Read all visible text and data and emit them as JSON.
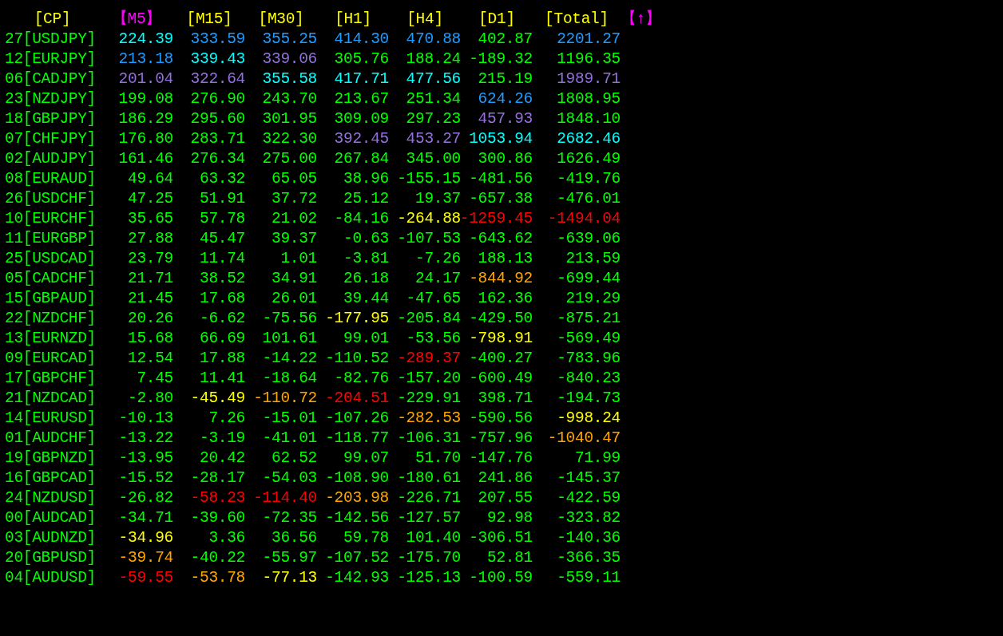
{
  "header": [
    {
      "text": "[CP]",
      "selected": false
    },
    {
      "text": "【M5】",
      "selected": true
    },
    {
      "text": "[M15]",
      "selected": false
    },
    {
      "text": "[M30]",
      "selected": false
    },
    {
      "text": "[H1]",
      "selected": false
    },
    {
      "text": "[H4]",
      "selected": false
    },
    {
      "text": "[D1]",
      "selected": false
    },
    {
      "text": "[Total]",
      "selected": false
    }
  ],
  "sort_indicator": "【↑】",
  "rows": [
    {
      "pair": "27[USDJPY]",
      "values": [
        {
          "text": "224.39",
          "color": "#00ffff"
        },
        {
          "text": "333.59",
          "color": "#1e9bff"
        },
        {
          "text": "355.25",
          "color": "#1e9bff"
        },
        {
          "text": "414.30",
          "color": "#1e9bff"
        },
        {
          "text": "470.88",
          "color": "#1e9bff"
        },
        {
          "text": "402.87",
          "color": "#00ff00"
        },
        {
          "text": "2201.27",
          "color": "#1e9bff"
        }
      ]
    },
    {
      "pair": "12[EURJPY]",
      "values": [
        {
          "text": "213.18",
          "color": "#1e9bff"
        },
        {
          "text": "339.43",
          "color": "#00ffff"
        },
        {
          "text": "339.06",
          "color": "#9370db"
        },
        {
          "text": "305.76",
          "color": "#00ff00"
        },
        {
          "text": "188.24",
          "color": "#00ff00"
        },
        {
          "text": "-189.32",
          "color": "#00ff00"
        },
        {
          "text": "1196.35",
          "color": "#00ff00"
        }
      ]
    },
    {
      "pair": "06[CADJPY]",
      "values": [
        {
          "text": "201.04",
          "color": "#9370db"
        },
        {
          "text": "322.64",
          "color": "#9370db"
        },
        {
          "text": "355.58",
          "color": "#00ffff"
        },
        {
          "text": "417.71",
          "color": "#00ffff"
        },
        {
          "text": "477.56",
          "color": "#00ffff"
        },
        {
          "text": "215.19",
          "color": "#00ff00"
        },
        {
          "text": "1989.71",
          "color": "#9370db"
        }
      ]
    },
    {
      "pair": "23[NZDJPY]",
      "values": [
        {
          "text": "199.08",
          "color": "#00ff00"
        },
        {
          "text": "276.90",
          "color": "#00ff00"
        },
        {
          "text": "243.70",
          "color": "#00ff00"
        },
        {
          "text": "213.67",
          "color": "#00ff00"
        },
        {
          "text": "251.34",
          "color": "#00ff00"
        },
        {
          "text": "624.26",
          "color": "#1e9bff"
        },
        {
          "text": "1808.95",
          "color": "#00ff00"
        }
      ]
    },
    {
      "pair": "18[GBPJPY]",
      "values": [
        {
          "text": "186.29",
          "color": "#00ff00"
        },
        {
          "text": "295.60",
          "color": "#00ff00"
        },
        {
          "text": "301.95",
          "color": "#00ff00"
        },
        {
          "text": "309.09",
          "color": "#00ff00"
        },
        {
          "text": "297.23",
          "color": "#00ff00"
        },
        {
          "text": "457.93",
          "color": "#9370db"
        },
        {
          "text": "1848.10",
          "color": "#00ff00"
        }
      ]
    },
    {
      "pair": "07[CHFJPY]",
      "values": [
        {
          "text": "176.80",
          "color": "#00ff00"
        },
        {
          "text": "283.71",
          "color": "#00ff00"
        },
        {
          "text": "322.30",
          "color": "#00ff00"
        },
        {
          "text": "392.45",
          "color": "#9370db"
        },
        {
          "text": "453.27",
          "color": "#9370db"
        },
        {
          "text": "1053.94",
          "color": "#00ffff"
        },
        {
          "text": "2682.46",
          "color": "#00ffff"
        }
      ]
    },
    {
      "pair": "02[AUDJPY]",
      "values": [
        {
          "text": "161.46",
          "color": "#00ff00"
        },
        {
          "text": "276.34",
          "color": "#00ff00"
        },
        {
          "text": "275.00",
          "color": "#00ff00"
        },
        {
          "text": "267.84",
          "color": "#00ff00"
        },
        {
          "text": "345.00",
          "color": "#00ff00"
        },
        {
          "text": "300.86",
          "color": "#00ff00"
        },
        {
          "text": "1626.49",
          "color": "#00ff00"
        }
      ]
    },
    {
      "pair": "08[EURAUD]",
      "values": [
        {
          "text": "49.64",
          "color": "#00ff00"
        },
        {
          "text": "63.32",
          "color": "#00ff00"
        },
        {
          "text": "65.05",
          "color": "#00ff00"
        },
        {
          "text": "38.96",
          "color": "#00ff00"
        },
        {
          "text": "-155.15",
          "color": "#00ff00"
        },
        {
          "text": "-481.56",
          "color": "#00ff00"
        },
        {
          "text": "-419.76",
          "color": "#00ff00"
        }
      ]
    },
    {
      "pair": "26[USDCHF]",
      "values": [
        {
          "text": "47.25",
          "color": "#00ff00"
        },
        {
          "text": "51.91",
          "color": "#00ff00"
        },
        {
          "text": "37.72",
          "color": "#00ff00"
        },
        {
          "text": "25.12",
          "color": "#00ff00"
        },
        {
          "text": "19.37",
          "color": "#00ff00"
        },
        {
          "text": "-657.38",
          "color": "#00ff00"
        },
        {
          "text": "-476.01",
          "color": "#00ff00"
        }
      ]
    },
    {
      "pair": "10[EURCHF]",
      "values": [
        {
          "text": "35.65",
          "color": "#00ff00"
        },
        {
          "text": "57.78",
          "color": "#00ff00"
        },
        {
          "text": "21.02",
          "color": "#00ff00"
        },
        {
          "text": "-84.16",
          "color": "#00ff00"
        },
        {
          "text": "-264.88",
          "color": "#ffff00"
        },
        {
          "text": "-1259.45",
          "color": "#ff0000"
        },
        {
          "text": "-1494.04",
          "color": "#ff0000"
        }
      ]
    },
    {
      "pair": "11[EURGBP]",
      "values": [
        {
          "text": "27.88",
          "color": "#00ff00"
        },
        {
          "text": "45.47",
          "color": "#00ff00"
        },
        {
          "text": "39.37",
          "color": "#00ff00"
        },
        {
          "text": "-0.63",
          "color": "#00ff00"
        },
        {
          "text": "-107.53",
          "color": "#00ff00"
        },
        {
          "text": "-643.62",
          "color": "#00ff00"
        },
        {
          "text": "-639.06",
          "color": "#00ff00"
        }
      ]
    },
    {
      "pair": "25[USDCAD]",
      "values": [
        {
          "text": "23.79",
          "color": "#00ff00"
        },
        {
          "text": "11.74",
          "color": "#00ff00"
        },
        {
          "text": "1.01",
          "color": "#00ff00"
        },
        {
          "text": "-3.81",
          "color": "#00ff00"
        },
        {
          "text": "-7.26",
          "color": "#00ff00"
        },
        {
          "text": "188.13",
          "color": "#00ff00"
        },
        {
          "text": "213.59",
          "color": "#00ff00"
        }
      ]
    },
    {
      "pair": "05[CADCHF]",
      "values": [
        {
          "text": "21.71",
          "color": "#00ff00"
        },
        {
          "text": "38.52",
          "color": "#00ff00"
        },
        {
          "text": "34.91",
          "color": "#00ff00"
        },
        {
          "text": "26.18",
          "color": "#00ff00"
        },
        {
          "text": "24.17",
          "color": "#00ff00"
        },
        {
          "text": "-844.92",
          "color": "#ffa500"
        },
        {
          "text": "-699.44",
          "color": "#00ff00"
        }
      ]
    },
    {
      "pair": "15[GBPAUD]",
      "values": [
        {
          "text": "21.45",
          "color": "#00ff00"
        },
        {
          "text": "17.68",
          "color": "#00ff00"
        },
        {
          "text": "26.01",
          "color": "#00ff00"
        },
        {
          "text": "39.44",
          "color": "#00ff00"
        },
        {
          "text": "-47.65",
          "color": "#00ff00"
        },
        {
          "text": "162.36",
          "color": "#00ff00"
        },
        {
          "text": "219.29",
          "color": "#00ff00"
        }
      ]
    },
    {
      "pair": "22[NZDCHF]",
      "values": [
        {
          "text": "20.26",
          "color": "#00ff00"
        },
        {
          "text": "-6.62",
          "color": "#00ff00"
        },
        {
          "text": "-75.56",
          "color": "#00ff00"
        },
        {
          "text": "-177.95",
          "color": "#ffff00"
        },
        {
          "text": "-205.84",
          "color": "#00ff00"
        },
        {
          "text": "-429.50",
          "color": "#00ff00"
        },
        {
          "text": "-875.21",
          "color": "#00ff00"
        }
      ]
    },
    {
      "pair": "13[EURNZD]",
      "values": [
        {
          "text": "15.68",
          "color": "#00ff00"
        },
        {
          "text": "66.69",
          "color": "#00ff00"
        },
        {
          "text": "101.61",
          "color": "#00ff00"
        },
        {
          "text": "99.01",
          "color": "#00ff00"
        },
        {
          "text": "-53.56",
          "color": "#00ff00"
        },
        {
          "text": "-798.91",
          "color": "#ffff00"
        },
        {
          "text": "-569.49",
          "color": "#00ff00"
        }
      ]
    },
    {
      "pair": "09[EURCAD]",
      "values": [
        {
          "text": "12.54",
          "color": "#00ff00"
        },
        {
          "text": "17.88",
          "color": "#00ff00"
        },
        {
          "text": "-14.22",
          "color": "#00ff00"
        },
        {
          "text": "-110.52",
          "color": "#00ff00"
        },
        {
          "text": "-289.37",
          "color": "#ff0000"
        },
        {
          "text": "-400.27",
          "color": "#00ff00"
        },
        {
          "text": "-783.96",
          "color": "#00ff00"
        }
      ]
    },
    {
      "pair": "17[GBPCHF]",
      "values": [
        {
          "text": "7.45",
          "color": "#00ff00"
        },
        {
          "text": "11.41",
          "color": "#00ff00"
        },
        {
          "text": "-18.64",
          "color": "#00ff00"
        },
        {
          "text": "-82.76",
          "color": "#00ff00"
        },
        {
          "text": "-157.20",
          "color": "#00ff00"
        },
        {
          "text": "-600.49",
          "color": "#00ff00"
        },
        {
          "text": "-840.23",
          "color": "#00ff00"
        }
      ]
    },
    {
      "pair": "21[NZDCAD]",
      "values": [
        {
          "text": "-2.80",
          "color": "#00ff00"
        },
        {
          "text": "-45.49",
          "color": "#ffff00"
        },
        {
          "text": "-110.72",
          "color": "#ffa500"
        },
        {
          "text": "-204.51",
          "color": "#ff0000"
        },
        {
          "text": "-229.91",
          "color": "#00ff00"
        },
        {
          "text": "398.71",
          "color": "#00ff00"
        },
        {
          "text": "-194.73",
          "color": "#00ff00"
        }
      ]
    },
    {
      "pair": "14[EURUSD]",
      "values": [
        {
          "text": "-10.13",
          "color": "#00ff00"
        },
        {
          "text": "7.26",
          "color": "#00ff00"
        },
        {
          "text": "-15.01",
          "color": "#00ff00"
        },
        {
          "text": "-107.26",
          "color": "#00ff00"
        },
        {
          "text": "-282.53",
          "color": "#ffa500"
        },
        {
          "text": "-590.56",
          "color": "#00ff00"
        },
        {
          "text": "-998.24",
          "color": "#ffff00"
        }
      ]
    },
    {
      "pair": "01[AUDCHF]",
      "values": [
        {
          "text": "-13.22",
          "color": "#00ff00"
        },
        {
          "text": "-3.19",
          "color": "#00ff00"
        },
        {
          "text": "-41.01",
          "color": "#00ff00"
        },
        {
          "text": "-118.77",
          "color": "#00ff00"
        },
        {
          "text": "-106.31",
          "color": "#00ff00"
        },
        {
          "text": "-757.96",
          "color": "#00ff00"
        },
        {
          "text": "-1040.47",
          "color": "#ffa500"
        }
      ]
    },
    {
      "pair": "19[GBPNZD]",
      "values": [
        {
          "text": "-13.95",
          "color": "#00ff00"
        },
        {
          "text": "20.42",
          "color": "#00ff00"
        },
        {
          "text": "62.52",
          "color": "#00ff00"
        },
        {
          "text": "99.07",
          "color": "#00ff00"
        },
        {
          "text": "51.70",
          "color": "#00ff00"
        },
        {
          "text": "-147.76",
          "color": "#00ff00"
        },
        {
          "text": "71.99",
          "color": "#00ff00"
        }
      ]
    },
    {
      "pair": "16[GBPCAD]",
      "values": [
        {
          "text": "-15.52",
          "color": "#00ff00"
        },
        {
          "text": "-28.17",
          "color": "#00ff00"
        },
        {
          "text": "-54.03",
          "color": "#00ff00"
        },
        {
          "text": "-108.90",
          "color": "#00ff00"
        },
        {
          "text": "-180.61",
          "color": "#00ff00"
        },
        {
          "text": "241.86",
          "color": "#00ff00"
        },
        {
          "text": "-145.37",
          "color": "#00ff00"
        }
      ]
    },
    {
      "pair": "24[NZDUSD]",
      "values": [
        {
          "text": "-26.82",
          "color": "#00ff00"
        },
        {
          "text": "-58.23",
          "color": "#ff0000"
        },
        {
          "text": "-114.40",
          "color": "#ff0000"
        },
        {
          "text": "-203.98",
          "color": "#ffa500"
        },
        {
          "text": "-226.71",
          "color": "#00ff00"
        },
        {
          "text": "207.55",
          "color": "#00ff00"
        },
        {
          "text": "-422.59",
          "color": "#00ff00"
        }
      ]
    },
    {
      "pair": "00[AUDCAD]",
      "values": [
        {
          "text": "-34.71",
          "color": "#00ff00"
        },
        {
          "text": "-39.60",
          "color": "#00ff00"
        },
        {
          "text": "-72.35",
          "color": "#00ff00"
        },
        {
          "text": "-142.56",
          "color": "#00ff00"
        },
        {
          "text": "-127.57",
          "color": "#00ff00"
        },
        {
          "text": "92.98",
          "color": "#00ff00"
        },
        {
          "text": "-323.82",
          "color": "#00ff00"
        }
      ]
    },
    {
      "pair": "03[AUDNZD]",
      "values": [
        {
          "text": "-34.96",
          "color": "#ffff00"
        },
        {
          "text": "3.36",
          "color": "#00ff00"
        },
        {
          "text": "36.56",
          "color": "#00ff00"
        },
        {
          "text": "59.78",
          "color": "#00ff00"
        },
        {
          "text": "101.40",
          "color": "#00ff00"
        },
        {
          "text": "-306.51",
          "color": "#00ff00"
        },
        {
          "text": "-140.36",
          "color": "#00ff00"
        }
      ]
    },
    {
      "pair": "20[GBPUSD]",
      "values": [
        {
          "text": "-39.74",
          "color": "#ffa500"
        },
        {
          "text": "-40.22",
          "color": "#00ff00"
        },
        {
          "text": "-55.97",
          "color": "#00ff00"
        },
        {
          "text": "-107.52",
          "color": "#00ff00"
        },
        {
          "text": "-175.70",
          "color": "#00ff00"
        },
        {
          "text": "52.81",
          "color": "#00ff00"
        },
        {
          "text": "-366.35",
          "color": "#00ff00"
        }
      ]
    },
    {
      "pair": "04[AUDUSD]",
      "values": [
        {
          "text": "-59.55",
          "color": "#ff0000"
        },
        {
          "text": "-53.78",
          "color": "#ffa500"
        },
        {
          "text": "-77.13",
          "color": "#ffff00"
        },
        {
          "text": "-142.93",
          "color": "#00ff00"
        },
        {
          "text": "-125.13",
          "color": "#00ff00"
        },
        {
          "text": "-100.59",
          "color": "#00ff00"
        },
        {
          "text": "-559.11",
          "color": "#00ff00"
        }
      ]
    }
  ]
}
